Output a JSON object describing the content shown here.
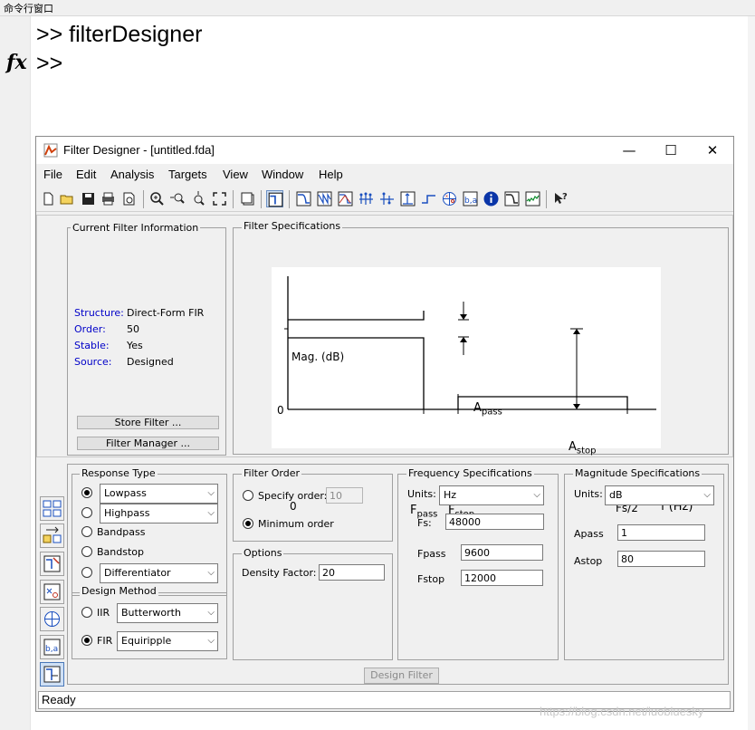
{
  "command_window": {
    "title": "命令行窗口",
    "line1": ">> filterDesigner",
    "line2": ">>",
    "fx": "fx"
  },
  "window": {
    "title": "Filter Designer - [untitled.fda]",
    "minimize": "—",
    "maximize": "☐",
    "close": "✕"
  },
  "menu": [
    "File",
    "Edit",
    "Analysis",
    "Targets",
    "View",
    "Window",
    "Help"
  ],
  "toolbar_icons": [
    "new-file-icon",
    "open-file-icon",
    "save-icon",
    "print-icon",
    "print-preview-icon",
    "zoom-in-icon",
    "zoom-x-icon",
    "zoom-y-icon",
    "full-view-icon",
    "new-figure-icon",
    "filter-specs-icon",
    "magnitude-response-icon",
    "phase-response-icon",
    "mag-phase-icon",
    "group-delay-icon",
    "phase-delay-icon",
    "impulse-response-icon",
    "step-response-icon",
    "pole-zero-icon",
    "coefficients-icon",
    "info-icon",
    "magnitude-estimate-icon",
    "noise-power-icon",
    "whats-this-icon"
  ],
  "current_filter": {
    "title": "Current Filter Information",
    "rows": [
      {
        "label": "Structure:",
        "value": "Direct-Form FIR"
      },
      {
        "label": "Order:",
        "value": "50"
      },
      {
        "label": "Stable:",
        "value": "Yes"
      },
      {
        "label": "Source:",
        "value": "Designed"
      }
    ],
    "store_filter": "Store Filter ...",
    "filter_manager": "Filter Manager ..."
  },
  "filter_specs": {
    "title": "Filter Specifications",
    "ylabel": "Mag. (dB)",
    "xlabel": "f (Hz)",
    "y0": "0",
    "x0": "0",
    "fpass": "F",
    "fpass_sub": "pass",
    "fstop": "F",
    "fstop_sub": "stop",
    "fs2": "Fs/2",
    "apass": "A",
    "apass_sub": "pass",
    "astop": "A",
    "astop_sub": "stop"
  },
  "response_type": {
    "title": "Response Type",
    "options": [
      {
        "label": "Lowpass",
        "selected": true,
        "dropdown": "Lowpass"
      },
      {
        "label": "Highpass",
        "selected": false,
        "dropdown": "Highpass"
      },
      {
        "label": "Bandpass",
        "selected": false
      },
      {
        "label": "Bandstop",
        "selected": false
      },
      {
        "label": "Differentiator",
        "selected": false,
        "dropdown": "Differentiator"
      }
    ]
  },
  "design_method": {
    "title": "Design Method",
    "iir_label": "IIR",
    "iir_value": "Butterworth",
    "fir_label": "FIR",
    "fir_value": "Equiripple",
    "selected": "FIR"
  },
  "filter_order": {
    "title": "Filter Order",
    "specify_label": "Specify order:",
    "specify_value": "10",
    "minimum_label": "Minimum order",
    "selected": "Minimum order"
  },
  "options": {
    "title": "Options",
    "density_label": "Density Factor:",
    "density_value": "20"
  },
  "frequency_specs": {
    "title": "Frequency Specifications",
    "units_label": "Units:",
    "units_value": "Hz",
    "fs_label": "Fs:",
    "fs_value": "48000",
    "fpass_label": "Fpass",
    "fpass_value": "9600",
    "fstop_label": "Fstop",
    "fstop_value": "12000"
  },
  "magnitude_specs": {
    "title": "Magnitude Specifications",
    "units_label": "Units:",
    "units_value": "dB",
    "apass_label": "Apass",
    "apass_value": "1",
    "astop_label": "Astop",
    "astop_value": "80"
  },
  "design_filter": "Design Filter",
  "status": "Ready",
  "watermark": "https://blog.csdn.net/luobluesky"
}
